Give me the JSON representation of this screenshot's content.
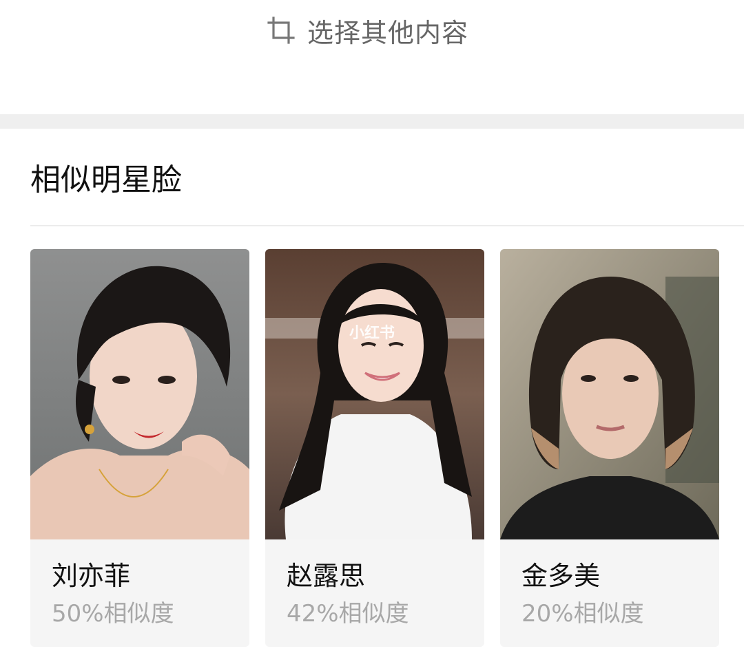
{
  "header": {
    "select_other_label": "选择其他内容",
    "icon": "crop-icon"
  },
  "section": {
    "title": "相似明星脸"
  },
  "cards": [
    {
      "name": "刘亦菲",
      "similarity": "50%相似度"
    },
    {
      "name": "赵露思",
      "similarity": "42%相似度",
      "watermark": "小红书"
    },
    {
      "name": "金多美",
      "similarity": "20%相似度"
    }
  ],
  "colors": {
    "background": "#ffffff",
    "section_gap": "#efefef",
    "card_background": "#f5f5f5",
    "secondary_text": "#a8a8a8",
    "primary_text": "#111111"
  }
}
